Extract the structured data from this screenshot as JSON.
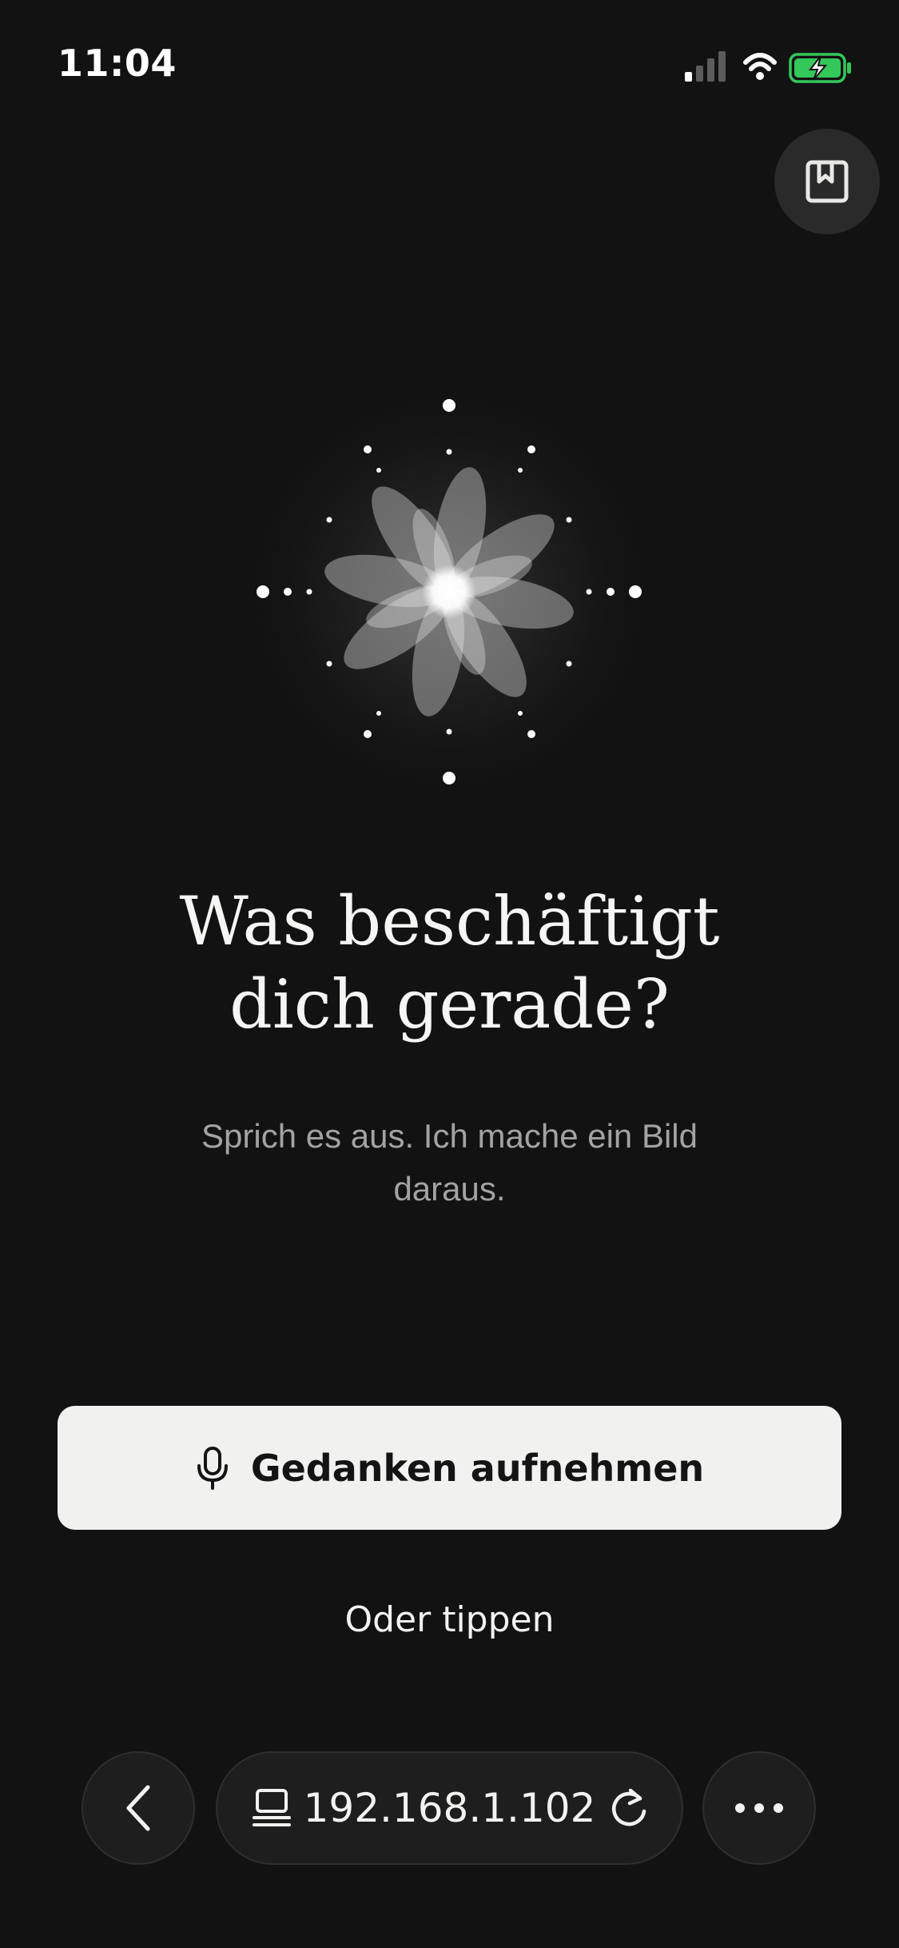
{
  "status_bar": {
    "time": "11:04",
    "icons": [
      "signal-icon",
      "wifi-icon",
      "battery-charging-icon"
    ],
    "battery_color": "#34c759"
  },
  "toolbar": {
    "bookmark_icon": "bookmark-icon"
  },
  "main": {
    "illustration": "flower-icon",
    "headline_line1": "Was beschäftigt",
    "headline_line2": "dich gerade?",
    "subtitle": "Sprich es aus. Ich mache ein Bild daraus.",
    "record_button_label": "Gedanken aufnehmen",
    "record_button_icon": "microphone-icon",
    "type_link_label": "Oder tippen"
  },
  "browser": {
    "back_icon": "chevron-left-icon",
    "tabs_icon": "tabs-icon",
    "address": "192.168.1.102",
    "reload_icon": "reload-icon",
    "more_icon": "more-icon"
  },
  "colors": {
    "background": "#121212",
    "button_background": "#f1f1ef",
    "button_text": "#141414",
    "subtitle_text": "#a3a3a1"
  }
}
